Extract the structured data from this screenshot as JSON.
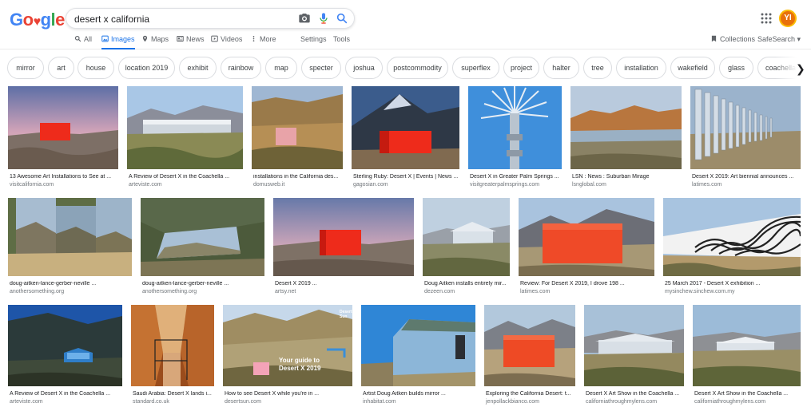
{
  "search": {
    "query": "desert x california"
  },
  "header": {
    "avatar_initials": "YI"
  },
  "tabs": [
    {
      "label": "All",
      "icon": "search-icon"
    },
    {
      "label": "Images",
      "icon": "image-icon",
      "active": true
    },
    {
      "label": "Maps",
      "icon": "map-pin-icon"
    },
    {
      "label": "News",
      "icon": "news-icon"
    },
    {
      "label": "Videos",
      "icon": "play-icon"
    },
    {
      "label": "More",
      "icon": "more-vert-icon"
    }
  ],
  "tools": {
    "settings": "Settings",
    "tools": "Tools",
    "collections": "Collections",
    "safesearch": "SafeSearch ▾"
  },
  "chips": [
    "mirror",
    "art",
    "house",
    "location 2019",
    "exhibit",
    "rainbow",
    "map",
    "specter",
    "joshua",
    "postcommodity",
    "superflex",
    "project",
    "halter",
    "tree",
    "installation",
    "wakefield",
    "glass",
    "coachella"
  ],
  "results": [
    {
      "caption": "13 Awesome Art Installations to See at ...",
      "source": "visitcalifornia.com"
    },
    {
      "caption": "A Review of Desert X in the Coachella ...",
      "source": "arteviste.com"
    },
    {
      "caption": "installations in the California des...",
      "source": "domusweb.it"
    },
    {
      "caption": "Sterling Ruby: Desert X | Events | News ...",
      "source": "gagosian.com"
    },
    {
      "caption": "Desert X in Greater Palm Springs ...",
      "source": "visitgreaterpalmsprings.com"
    },
    {
      "caption": "LSN : News : Suburban Mirage",
      "source": "lsnglobal.com"
    },
    {
      "caption": "Desert X 2019: Art biennial announces ...",
      "source": "latimes.com"
    },
    {
      "caption": "doug-aitken-lance-gerber-neville ...",
      "source": "anothersomething.org"
    },
    {
      "caption": "doug-aitken-lance-gerber-neville ...",
      "source": "anothersomething.org"
    },
    {
      "caption": "Desert X 2019 ...",
      "source": "artsy.net"
    },
    {
      "caption": "Doug Aitken installs entirely mir...",
      "source": "dezeen.com"
    },
    {
      "caption": "Review: For Desert X 2019, I drove 198 ...",
      "source": "latimes.com"
    },
    {
      "caption": "25 March 2017 - Desert X exhibition ...",
      "source": "mysinchew.sinchew.com.my"
    },
    {
      "caption": "A Review of Desert X in the Coachella ...",
      "source": "arteviste.com"
    },
    {
      "caption": "Saudi Arabia: Desert X lands i...",
      "source": "standard.co.uk"
    },
    {
      "caption": "How to see Desert X while you're in ...",
      "source": "desertsun.com",
      "overlay": "Your guide to Desert X 2019",
      "corner": "Desert Sun"
    },
    {
      "caption": "Artist Doug Aitken builds mirror ...",
      "source": "inhabitat.com"
    },
    {
      "caption": "Exploring the California Desert: t...",
      "source": "jenpollackbianco.com"
    },
    {
      "caption": "Desert X Art Show in the Coachella ...",
      "source": "californiathroughmylens.com"
    },
    {
      "caption": "Desert X Art Show in the Coachella ...",
      "source": "californiathroughmylens.com"
    }
  ],
  "colors": {
    "accent": "#1a73e8",
    "red_cube": "#ee2b1b",
    "link_gray": "#70757a"
  }
}
